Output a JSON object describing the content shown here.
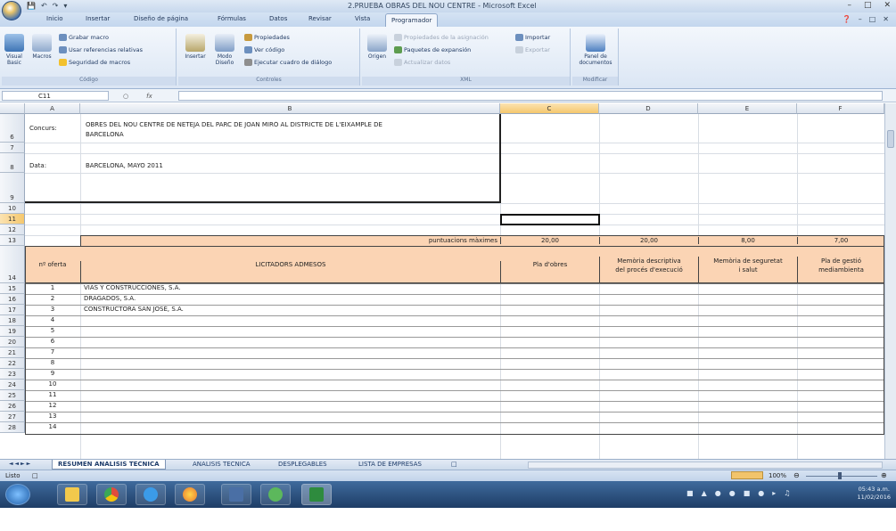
{
  "window": {
    "title": "2.PRUEBA OBRAS DEL NOU CENTRE - Microsoft Excel",
    "qat_icons": [
      "save-icon",
      "undo-icon",
      "redo-icon",
      "customize-icon"
    ],
    "controls": [
      "–",
      "□",
      "✕"
    ]
  },
  "ribbon": {
    "tabs": [
      "Inicio",
      "Insertar",
      "Diseño de página",
      "Fórmulas",
      "Datos",
      "Revisar",
      "Vista",
      "Programador"
    ],
    "active_tab": "Programador",
    "help_ctrls": [
      "❓",
      "–",
      "□",
      "✕"
    ],
    "groups": {
      "codigo": {
        "label": "Código",
        "visual_basic": "Visual Basic",
        "macros": "Macros",
        "grabar_macro": "Grabar macro",
        "usar_referencias": "Usar referencias relativas",
        "seguridad": "Seguridad de macros"
      },
      "controles": {
        "label": "Controles",
        "insertar": "Insertar",
        "modo_diseno": "Modo Diseño",
        "propiedades": "Propiedades",
        "ver_codigo": "Ver código",
        "ejecutar": "Ejecutar cuadro de diálogo"
      },
      "xml": {
        "label": "XML",
        "origen": "Origen",
        "propiedades_asignacion": "Propiedades de la asignación",
        "paquetes": "Paquetes de expansión",
        "actualizar": "Actualizar datos",
        "importar": "Importar",
        "exportar": "Exportar"
      },
      "modificar": {
        "label": "Modificar",
        "panel": "Panel de documentos"
      }
    }
  },
  "formula_bar": {
    "name_box": "C11",
    "fx": "fx",
    "value": ""
  },
  "grid": {
    "columns": [
      "A",
      "B",
      "C",
      "D",
      "E",
      "F"
    ],
    "selected_column": "C",
    "selected_row": "11",
    "rows": [
      "6",
      "7",
      "8",
      "9",
      "10",
      "11",
      "12",
      "13",
      "14",
      "15",
      "16",
      "17",
      "18",
      "19",
      "20",
      "21",
      "22",
      "23",
      "24",
      "25",
      "26",
      "27",
      "28"
    ],
    "concurs_label": "Concurs:",
    "concurs_text_1": "OBRES DEL NOU CENTRE DE NETEJA DEL PARC DE JOAN MIRÓ AL DISTRICTE DE L'EIXAMPLE DE",
    "concurs_text_2": "BARCELONA",
    "data_label": "Data:",
    "data_text": "BARCELONA, MAYO 2011",
    "puntuacions": "puntuacions màximes",
    "scores": [
      "20,00",
      "20,00",
      "8,00",
      "7,00"
    ],
    "header_num_oferta": "nº oferta",
    "header_licitadors": "LICITADORS ADMESOS",
    "header_c": "Pla d'obres",
    "header_d_1": "Memòria descriptiva",
    "header_d_2": "del procés d'execució",
    "header_e_1": "Memòria de seguretat",
    "header_e_2": "i salut",
    "header_f_1": "Pla de gestió",
    "header_f_2": "mediambienta",
    "offers": [
      {
        "n": "1",
        "name": "VIAS Y CONSTRUCCIONES, S.A."
      },
      {
        "n": "2",
        "name": "DRAGADOS, S.A."
      },
      {
        "n": "3",
        "name": "CONSTRUCTORA SAN JOSÉ, S.A."
      },
      {
        "n": "4",
        "name": ""
      },
      {
        "n": "5",
        "name": ""
      },
      {
        "n": "6",
        "name": ""
      },
      {
        "n": "7",
        "name": ""
      },
      {
        "n": "8",
        "name": ""
      },
      {
        "n": "9",
        "name": ""
      },
      {
        "n": "10",
        "name": ""
      },
      {
        "n": "11",
        "name": ""
      },
      {
        "n": "12",
        "name": ""
      },
      {
        "n": "13",
        "name": ""
      },
      {
        "n": "14",
        "name": ""
      }
    ]
  },
  "sheets": {
    "nav": "◄ ◄ ► ►",
    "tabs": [
      "RESUMEN ANALISIS TECNICA",
      "ANALISIS TECNICA",
      "DESPLEGABLES",
      "LISTA DE EMPRESAS"
    ],
    "active": "RESUMEN ANALISIS TECNICA"
  },
  "status": {
    "ready": "Listo",
    "zoom": "100%"
  },
  "taskbar": {
    "time": "05:43 a.m.",
    "date": "11/02/2016",
    "colors": {
      "start": "#3a8ad6",
      "explorer": "#f2c94c",
      "chrome": "#e04c3c",
      "ie": "#3b9be8",
      "firefox": "#e8772e",
      "media": "#4a6fa5",
      "utorrent": "#5cb85c",
      "excel": "#2e8b3e"
    }
  }
}
